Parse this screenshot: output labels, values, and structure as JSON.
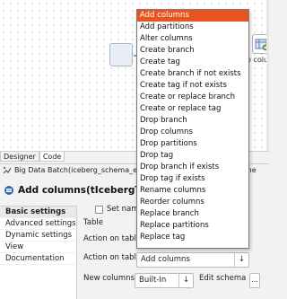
{
  "canvas": {
    "right_component_label": "op colu"
  },
  "tabs": [
    {
      "label": "Designer",
      "active": false
    },
    {
      "label": "Code",
      "active": true
    }
  ],
  "job": {
    "title": "Big Data Batch(iceberg_schema_evo",
    "title_right": "g_sche"
  },
  "component": {
    "title": "Add columns(tIcebergTable_"
  },
  "nav": {
    "items": [
      {
        "label": "Basic settings",
        "active": true
      },
      {
        "label": "Advanced settings",
        "active": false
      },
      {
        "label": "Dynamic settings",
        "active": false
      },
      {
        "label": "View",
        "active": false
      },
      {
        "label": "Documentation",
        "active": false
      }
    ]
  },
  "form": {
    "set_namespace_label": "Set namesp",
    "table_label": "Table",
    "action_on_table_label_1": "Action on table",
    "action_on_table_label_2": "Action on table",
    "action_on_table_value": "Add columns",
    "new_columns_label": "New columns",
    "new_columns_value": "Built-In",
    "edit_schema_label": "Edit schema",
    "edit_schema_button": "..."
  },
  "dropdown": {
    "selected": "Add columns",
    "options": [
      "Add columns",
      "Add partitions",
      "Alter columns",
      "Create branch",
      "Create tag",
      "Create branch if not exists",
      "Create tag if not exists",
      "Create or replace branch",
      "Create or replace tag",
      "Drop branch",
      "Drop columns",
      "Drop partitions",
      "Drop tag",
      "Drop branch if exists",
      "Drop tag if exists",
      "Rename columns",
      "Reorder columns",
      "Replace branch",
      "Replace partitions",
      "Replace tag"
    ]
  },
  "colors": {
    "selection": "#e95420",
    "background": "#f2f2f2"
  }
}
